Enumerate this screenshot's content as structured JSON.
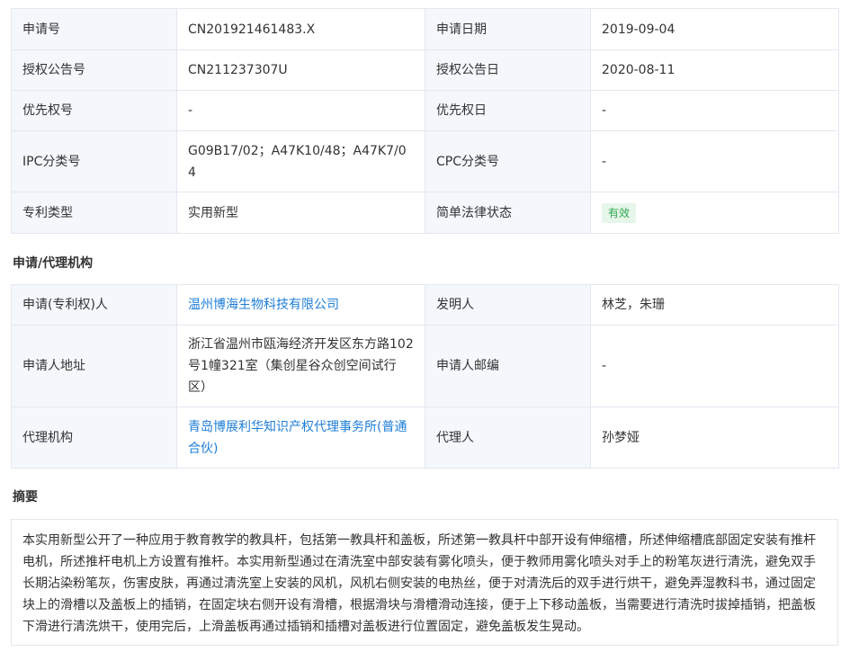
{
  "basic_info": {
    "rows": [
      {
        "label1": "申请号",
        "value1": "CN201921461483.X",
        "label2": "申请日期",
        "value2": "2019-09-04"
      },
      {
        "label1": "授权公告号",
        "value1": "CN211237307U",
        "label2": "授权公告日",
        "value2": "2020-08-11"
      },
      {
        "label1": "优先权号",
        "value1": "-",
        "label2": "优先权日",
        "value2": "-"
      },
      {
        "label1": "IPC分类号",
        "value1": "G09B17/02；A47K10/48；A47K7/04",
        "label2": "CPC分类号",
        "value2": "-"
      },
      {
        "label1": "专利类型",
        "value1": "实用新型",
        "label2": "简单法律状态",
        "value2": "有效"
      }
    ]
  },
  "agency": {
    "title": "申请/代理机构",
    "rows": [
      {
        "label1": "申请(专利权)人",
        "value1": "温州博海生物科技有限公司",
        "label2": "发明人",
        "value2": "林芝，朱珊"
      },
      {
        "label1": "申请人地址",
        "value1": "浙江省温州市瓯海经济开发区东方路102号1幢321室（集创星谷众创空间试行区）",
        "label2": "申请人邮编",
        "value2": "-"
      },
      {
        "label1": "代理机构",
        "value1": "青岛博展利华知识产权代理事务所(普通合伙)",
        "label2": "代理人",
        "value2": "孙梦娅"
      }
    ]
  },
  "abstract": {
    "title": "摘要",
    "text": "本实用新型公开了一种应用于教育教学的教具杆，包括第一教具杆和盖板，所述第一教具杆中部开设有伸缩槽，所述伸缩槽底部固定安装有推杆电机，所述推杆电机上方设置有推杆。本实用新型通过在清洗室中部安装有雾化喷头，便于教师用雾化喷头对手上的粉笔灰进行清洗，避免双手长期沾染粉笔灰，伤害皮肤，再通过清洗室上安装的风机，风机右侧安装的电热丝，便于对清洗后的双手进行烘干，避免弄湿教科书，通过固定块上的滑槽以及盖板上的插销，在固定块右侧开设有滑槽，根据滑块与滑槽滑动连接，便于上下移动盖板，当需要进行清洗时拔掉插销，把盖板下滑进行清洗烘干，使用完后，上滑盖板再通过插销和插槽对盖板进行位置固定，避免盖板发生晃动。"
  },
  "colors": {
    "label_bg": "#f4f7fb",
    "border": "#e4e8ef",
    "link": "#1e7ed8",
    "badge_bg": "#e7f6ea",
    "badge_text": "#2fa84f"
  }
}
